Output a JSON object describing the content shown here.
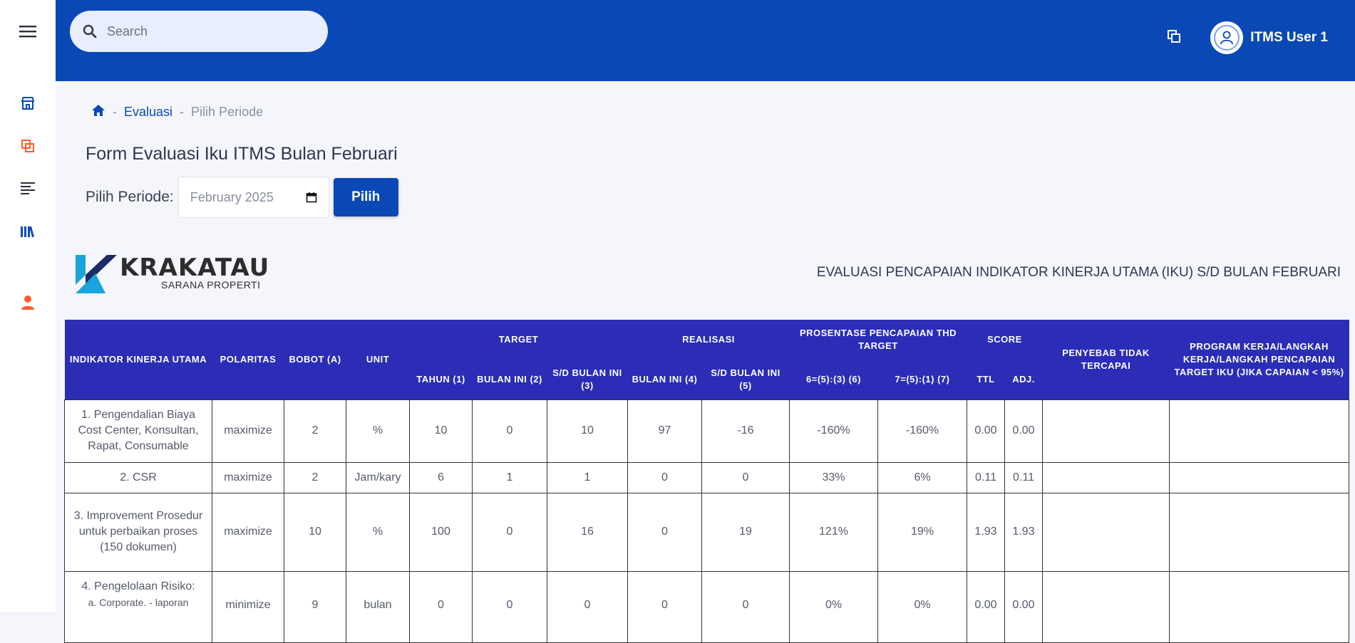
{
  "topbar": {
    "search_placeholder": "Search",
    "username": "ITMS User 1",
    "colors": {
      "bar": "#0a49b5",
      "accent": "#ff5b2e"
    }
  },
  "sidebar": {
    "icons": [
      "menu-icon",
      "store-icon",
      "copy-icon",
      "list-icon",
      "library-icon",
      "user-icon"
    ]
  },
  "breadcrumb": {
    "home_icon": "home-icon",
    "evaluasi": "Evaluasi",
    "current": "Pilih Periode"
  },
  "page": {
    "title": "Form Evaluasi Iku ITMS Bulan Februari",
    "periode_label": "Pilih Periode:",
    "periode_value": "February 2025",
    "pilih_button": "Pilih"
  },
  "logo": {
    "main": "KRAKATAU",
    "sub": "SARANA PROPERTI"
  },
  "report_title": "EVALUASI PENCAPAIAN INDIKATOR KINERJA UTAMA (IKU) S/D BULAN FEBRUARI",
  "table": {
    "headers": {
      "indikator": "INDIKATOR KINERJA UTAMA",
      "polaritas": "POLARITAS",
      "bobot": "BOBOT (A)",
      "unit": "UNIT",
      "target": "TARGET",
      "realisasi": "REALISASI",
      "prosentase": "PROSENTASE PENCAPAIAN THD TARGET",
      "score": "SCORE",
      "penyebab": "PENYEBAB TIDAK TERCAPAI",
      "program": "PROGRAM KERJA/LANGKAH KERJA/LANGKAH PENCAPAIAN TARGET IKU (JIKA CAPAIAN < 95%)",
      "tahun": "TAHUN (1)",
      "bulan_ini_2": "BULAN INI (2)",
      "sd_bulan_3": "S/D BULAN INI (3)",
      "bulan_ini_4": "BULAN INI (4)",
      "sd_bulan_5": "S/D BULAN INI (5)",
      "p6": "6=(5):(3) (6)",
      "p7": "7=(5):(1) (7)",
      "ttl": "TTL",
      "adj": "ADJ."
    },
    "rows": [
      {
        "indikator": "1. Pengendalian Biaya Cost Center, Konsultan, Rapat, Consumable",
        "sub": "",
        "polaritas": "maximize",
        "bobot": "2",
        "unit": "%",
        "tahun": "10",
        "bulan_ini": "0",
        "sd_bulan": "10",
        "r_bulan_ini": "97",
        "r_sd_bulan": "-16",
        "p6": "-160%",
        "p7": "-160%",
        "ttl": "0.00",
        "adj": "0.00"
      },
      {
        "indikator": "2. CSR",
        "sub": "",
        "polaritas": "maximize",
        "bobot": "2",
        "unit": "Jam/kary",
        "tahun": "6",
        "bulan_ini": "1",
        "sd_bulan": "1",
        "r_bulan_ini": "0",
        "r_sd_bulan": "0",
        "p6": "33%",
        "p7": "6%",
        "ttl": "0.11",
        "adj": "0.11"
      },
      {
        "indikator": "3. Improvement Prosedur untuk perbaikan proses (150 dokumen)",
        "sub": "",
        "polaritas": "maximize",
        "bobot": "10",
        "unit": "%",
        "tahun": "100",
        "bulan_ini": "0",
        "sd_bulan": "16",
        "r_bulan_ini": "0",
        "r_sd_bulan": "19",
        "p6": "121%",
        "p7": "19%",
        "ttl": "1.93",
        "adj": "1.93"
      },
      {
        "indikator": "4. Pengelolaan Risiko:",
        "sub": "a. Corporate. - laporan",
        "polaritas": "minimize",
        "bobot": "9",
        "unit": "bulan",
        "tahun": "0",
        "bulan_ini": "0",
        "sd_bulan": "0",
        "r_bulan_ini": "0",
        "r_sd_bulan": "0",
        "p6": "0%",
        "p7": "0%",
        "ttl": "0.00",
        "adj": "0.00"
      }
    ]
  }
}
